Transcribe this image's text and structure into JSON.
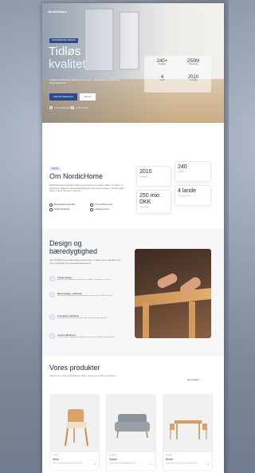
{
  "nav": {
    "logo": "NordicHome",
    "links": [
      "Om os",
      "Design",
      "Bæredygtighed",
      "Produkter",
      "Kontakt"
    ]
  },
  "hero": {
    "badge": "SKANDINAVISK DESIGN",
    "title_line1": "Tidløs",
    "title_line2": "kvalitet",
    "subtitle": "Nordisk møbeldesign skabt til generationer – bæredygtige materialer og ærligt håndværk.",
    "primary_button": "Udforsk kollektionen",
    "secondary_button": "Om os",
    "features": [
      "FSC-certificeret træ",
      "10 års garanti"
    ],
    "stats": [
      {
        "value": "240+",
        "label": "Designs"
      },
      {
        "value": "250M",
        "label": "Omsætning"
      },
      {
        "value": "4",
        "label": "Lande"
      },
      {
        "value": "2010",
        "label": "Grundlagt"
      }
    ]
  },
  "about": {
    "badge": "OM OS",
    "title": "Om NordicHome",
    "text": "NordicHome blev grundlagt i 2010 med et ønske om at skabe møbler, der holder. Vi kombinerer traditionelt skandinavisk håndværk med moderne design, så hvert stykke bliver en del af hjemmet i mange år.",
    "checks": [
      "Bæredygtige materialer",
      "FSC-certificeret træ",
      "Dansk håndværk",
      "Livslang service"
    ],
    "stats": [
      {
        "value": "2010",
        "label": "Grundlagt"
      },
      {
        "value": "240",
        "label": "Designs"
      },
      {
        "value": "250 mio. DKK",
        "label": "Omsætning"
      },
      {
        "value": "4 lande",
        "label": "Tilstedeværelse"
      }
    ]
  },
  "design": {
    "title_line1": "Design og",
    "title_line2": "bæredygtighed",
    "intro": "Hos NordicHome er kvalitet aldrig et kompromis. Vi vælger vores materialer med omhu og arbejder tæt med lokale håndværkere.",
    "features": [
      {
        "title": "Tidløst design",
        "desc": "Enkle linjer og naturlige materialer, der holder sig moderne år efter år."
      },
      {
        "title": "Bæredygtige materialer",
        "desc": "Alt vores træ kommer fra ansvarligt drevne skove og er FSC-certificeret."
      },
      {
        "title": "Ansvarlig produktion",
        "desc": "Vi producerer lokalt og minimerer spild i hele produktionskæden."
      },
      {
        "title": "Lang holdbarhed",
        "desc": "Vores møbler er bygget til at holde og leveres med mulighed for reparation."
      }
    ]
  },
  "products": {
    "title": "Vores produkter",
    "subtitle": "Udforsk vores udvalg af håndlavede møbler, designet til at holde i generationer.",
    "sort_label": "Alle produkter",
    "items": [
      {
        "category": "STOLE",
        "name": "Stole",
        "desc": "Massivt egetræ og naturligt polstret sæde."
      },
      {
        "category": "SOFAER",
        "name": "Sofaer",
        "desc": "Tidløse sofaer i bæredygtige tekstiler."
      },
      {
        "category": "BORDE",
        "name": "Borde",
        "desc": "Spiseborde i massivt træ til hverdag og fest."
      }
    ]
  },
  "colors": {
    "accent": "#2b4a8b",
    "text_dark": "#1f2a3d"
  }
}
